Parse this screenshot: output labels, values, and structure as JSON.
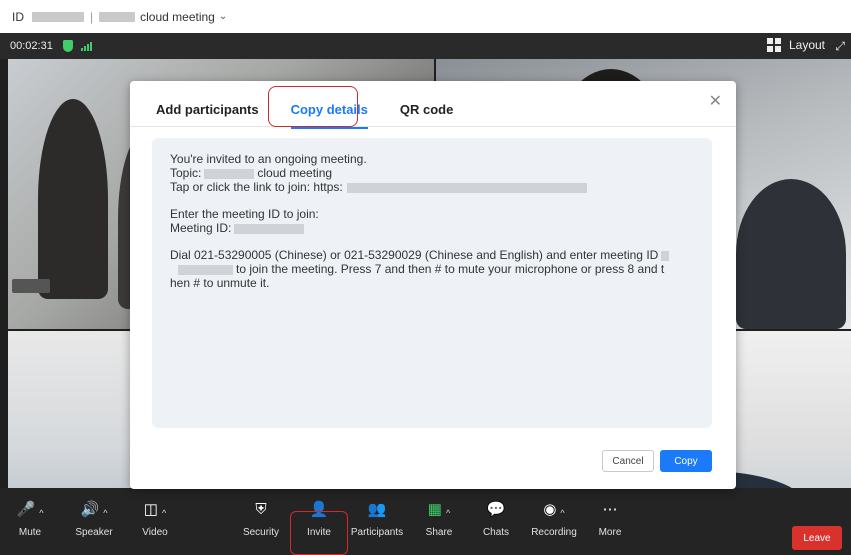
{
  "title_bar": {
    "id_label": "ID",
    "meeting_name": "cloud meeting"
  },
  "status_bar": {
    "elapsed_time": "00:02:31",
    "layout_label": "Layout"
  },
  "dialog": {
    "tabs": [
      {
        "label": "Add participants",
        "active": false
      },
      {
        "label": "Copy details",
        "active": true
      },
      {
        "label": "QR code",
        "active": false
      }
    ],
    "invite_text": {
      "line1": "You're invited to an ongoing meeting.",
      "topic_prefix": "Topic:",
      "topic_suffix": "cloud meeting",
      "link_prefix": "Tap or click the link to join: https:",
      "enter_id": "Enter the meeting ID to join:",
      "meeting_id_prefix": "Meeting ID:",
      "dial_line1": "Dial 021-53290005 (Chinese) or 021-53290029 (Chinese and English) and enter meeting ID",
      "dial_line2": "to join the meeting. Press 7 and then # to mute your microphone or press 8 and t",
      "dial_line3": "hen # to unmute it."
    },
    "cancel_label": "Cancel",
    "copy_label": "Copy"
  },
  "toolbar": {
    "items": [
      {
        "label": "Mute",
        "icon": "mic-muted-icon"
      },
      {
        "label": "Speaker",
        "icon": "speaker-icon"
      },
      {
        "label": "Video",
        "icon": "video-off-icon"
      },
      {
        "label": "Security",
        "icon": "shield-icon"
      },
      {
        "label": "Invite",
        "icon": "invite-icon"
      },
      {
        "label": "Participants",
        "icon": "participants-icon"
      },
      {
        "label": "Share",
        "icon": "share-icon"
      },
      {
        "label": "Chats",
        "icon": "chat-icon"
      },
      {
        "label": "Recording",
        "icon": "record-icon"
      },
      {
        "label": "More",
        "icon": "more-icon"
      }
    ],
    "leave_label": "Leave"
  },
  "colors": {
    "accent": "#1a7af8",
    "highlight": "#d12a2a",
    "leave": "#d9312b",
    "secure": "#3ecf6a"
  }
}
